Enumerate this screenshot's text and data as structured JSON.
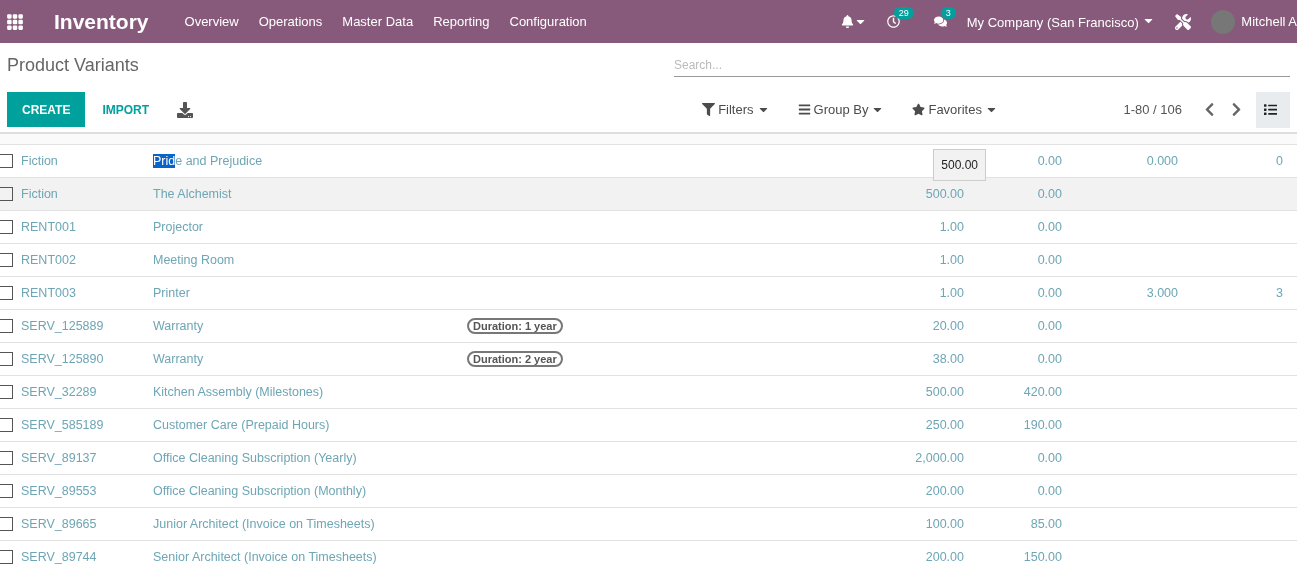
{
  "navbar": {
    "app_title": "Inventory",
    "menus": [
      "Overview",
      "Operations",
      "Master Data",
      "Reporting",
      "Configuration"
    ],
    "activity_badge": "29",
    "messages_badge": "3",
    "company": "My Company (San Francisco)",
    "user": "Mitchell A"
  },
  "page_title": "Product Variants",
  "search": {
    "placeholder": "Search..."
  },
  "buttons": {
    "create": "CREATE",
    "import": "IMPORT"
  },
  "filters": [
    "Filters",
    "Group By",
    "Favorites"
  ],
  "pager": "1-80 / 106",
  "rows": [
    {
      "ref": "Fiction",
      "name_parts": [
        {
          "text": "Prid",
          "highlighted": true
        },
        {
          "text": "e and Prejudice",
          "highlighted": false
        }
      ],
      "attribute": "",
      "price": "",
      "cost": "0.00",
      "column_5": "0.000",
      "column_6": "0",
      "tooltip": "500.00",
      "hovered": false
    },
    {
      "ref": "Fiction",
      "name_parts": [
        {
          "text": "The Alchemist",
          "highlighted": false
        }
      ],
      "attribute": "",
      "price": "500.00",
      "cost": "0.00",
      "column_5": "",
      "column_6": "",
      "hovered": true
    },
    {
      "ref": "RENT001",
      "name_parts": [
        {
          "text": "Projector",
          "highlighted": false
        }
      ],
      "attribute": "",
      "price": "1.00",
      "cost": "0.00",
      "column_5": "",
      "column_6": "",
      "hovered": false
    },
    {
      "ref": "RENT002",
      "name_parts": [
        {
          "text": "Meeting Room",
          "highlighted": false
        }
      ],
      "attribute": "",
      "price": "1.00",
      "cost": "0.00",
      "column_5": "",
      "column_6": "",
      "hovered": false
    },
    {
      "ref": "RENT003",
      "name_parts": [
        {
          "text": "Printer",
          "highlighted": false
        }
      ],
      "attribute": "",
      "price": "1.00",
      "cost": "0.00",
      "column_5": "3.000",
      "column_6": "3",
      "hovered": false
    },
    {
      "ref": "SERV_125889",
      "name_parts": [
        {
          "text": "Warranty",
          "highlighted": false
        }
      ],
      "attribute": "Duration: 1 year",
      "price": "20.00",
      "cost": "0.00",
      "column_5": "",
      "column_6": "",
      "hovered": false
    },
    {
      "ref": "SERV_125890",
      "name_parts": [
        {
          "text": "Warranty",
          "highlighted": false
        }
      ],
      "attribute": "Duration: 2 year",
      "price": "38.00",
      "cost": "0.00",
      "column_5": "",
      "column_6": "",
      "hovered": false
    },
    {
      "ref": "SERV_32289",
      "name_parts": [
        {
          "text": "Kitchen Assembly (Milestones)",
          "highlighted": false
        }
      ],
      "attribute": "",
      "price": "500.00",
      "cost": "420.00",
      "column_5": "",
      "column_6": "",
      "hovered": false
    },
    {
      "ref": "SERV_585189",
      "name_parts": [
        {
          "text": "Customer Care (Prepaid Hours)",
          "highlighted": false
        }
      ],
      "attribute": "",
      "price": "250.00",
      "cost": "190.00",
      "column_5": "",
      "column_6": "",
      "hovered": false
    },
    {
      "ref": "SERV_89137",
      "name_parts": [
        {
          "text": "Office Cleaning Subscription (Yearly)",
          "highlighted": false
        }
      ],
      "attribute": "",
      "price": "2,000.00",
      "cost": "0.00",
      "column_5": "",
      "column_6": "",
      "hovered": false
    },
    {
      "ref": "SERV_89553",
      "name_parts": [
        {
          "text": "Office Cleaning Subscription (Monthly)",
          "highlighted": false
        }
      ],
      "attribute": "",
      "price": "200.00",
      "cost": "0.00",
      "column_5": "",
      "column_6": "",
      "hovered": false
    },
    {
      "ref": "SERV_89665",
      "name_parts": [
        {
          "text": "Junior Architect (Invoice on Timesheets)",
          "highlighted": false
        }
      ],
      "attribute": "",
      "price": "100.00",
      "cost": "85.00",
      "column_5": "",
      "column_6": "",
      "hovered": false
    },
    {
      "ref": "SERV_89744",
      "name_parts": [
        {
          "text": "Senior Architect (Invoice on Timesheets)",
          "highlighted": false
        }
      ],
      "attribute": "",
      "price": "200.00",
      "cost": "150.00",
      "column_5": "",
      "column_6": "",
      "hovered": false
    }
  ]
}
